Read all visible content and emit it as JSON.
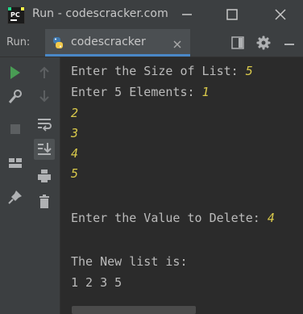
{
  "window": {
    "title": "Run - codescracker.com",
    "logo_text": "PC"
  },
  "run_panel": {
    "label": "Run:",
    "tab_label": "codescracker"
  },
  "console": {
    "lines": [
      {
        "prompt": "Enter the Size of List: ",
        "input": "5"
      },
      {
        "prompt": "Enter 5 Elements: ",
        "input": "1"
      },
      {
        "prompt": "",
        "input": "2"
      },
      {
        "prompt": "",
        "input": "3"
      },
      {
        "prompt": "",
        "input": "4"
      },
      {
        "prompt": "",
        "input": "5"
      },
      {
        "prompt": "",
        "input": ""
      },
      {
        "prompt": "Enter the Value to Delete: ",
        "input": "4"
      },
      {
        "prompt": "",
        "input": ""
      },
      {
        "prompt": "The New list is:",
        "input": ""
      },
      {
        "prompt": "1 2 3 5",
        "input": ""
      }
    ]
  },
  "colors": {
    "background": "#2b2b2b",
    "chrome": "#3c3f41",
    "output_text": "#bbbbbb",
    "input_text": "#d9c94b",
    "run_green": "#499c54",
    "tab_accent": "#4a88c7"
  },
  "icons": {
    "left_toolbar": [
      "run-icon",
      "wrench-icon",
      "stop-icon",
      "layout-icon",
      "pin-icon"
    ],
    "right_toolbar": [
      "up-arrow-icon",
      "down-arrow-icon",
      "soft-wrap-icon",
      "scroll-to-end-icon",
      "print-icon",
      "trash-icon"
    ],
    "header": [
      "layout-toggle-icon",
      "settings-icon",
      "minimize-panel-icon"
    ]
  }
}
